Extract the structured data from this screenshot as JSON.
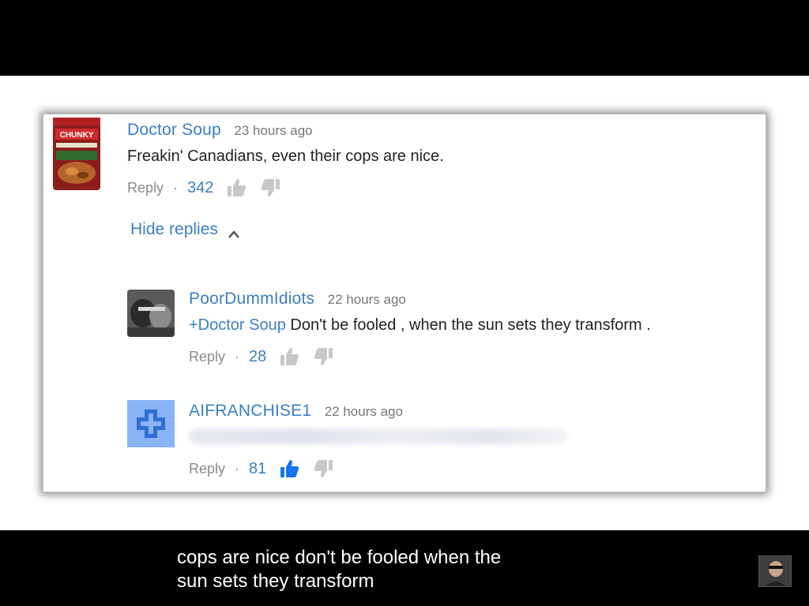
{
  "comments": [
    {
      "author": "Doctor Soup",
      "time": "23 hours ago",
      "text": "Freakin' Canadians, even their cops are nice.",
      "reply_label": "Reply",
      "separator": "·",
      "likes": "342",
      "avatar": "chunky-soup-can-avatar"
    }
  ],
  "hide_replies_label": "Hide replies",
  "replies": [
    {
      "author": "PoorDummIdiots",
      "time": "22 hours ago",
      "mention": "+Doctor Soup",
      "text": " Don't be fooled , when the sun sets they transform .",
      "reply_label": "Reply",
      "separator": "·",
      "likes": "28",
      "liked": false,
      "avatar": "photo-avatar"
    },
    {
      "author": "AIFRANCHISE1",
      "time": "22 hours ago",
      "reply_label": "Reply",
      "separator": "·",
      "likes": "81",
      "liked": true,
      "avatar": "blue-cross-avatar"
    }
  ],
  "caption": {
    "line1": "cops are nice don't be fooled when the",
    "line2": "sun sets they transform"
  },
  "colors": {
    "link_blue": "#3b7ec4",
    "liked_blue": "#1a73e8",
    "muted_gray": "#8a8a8a"
  }
}
